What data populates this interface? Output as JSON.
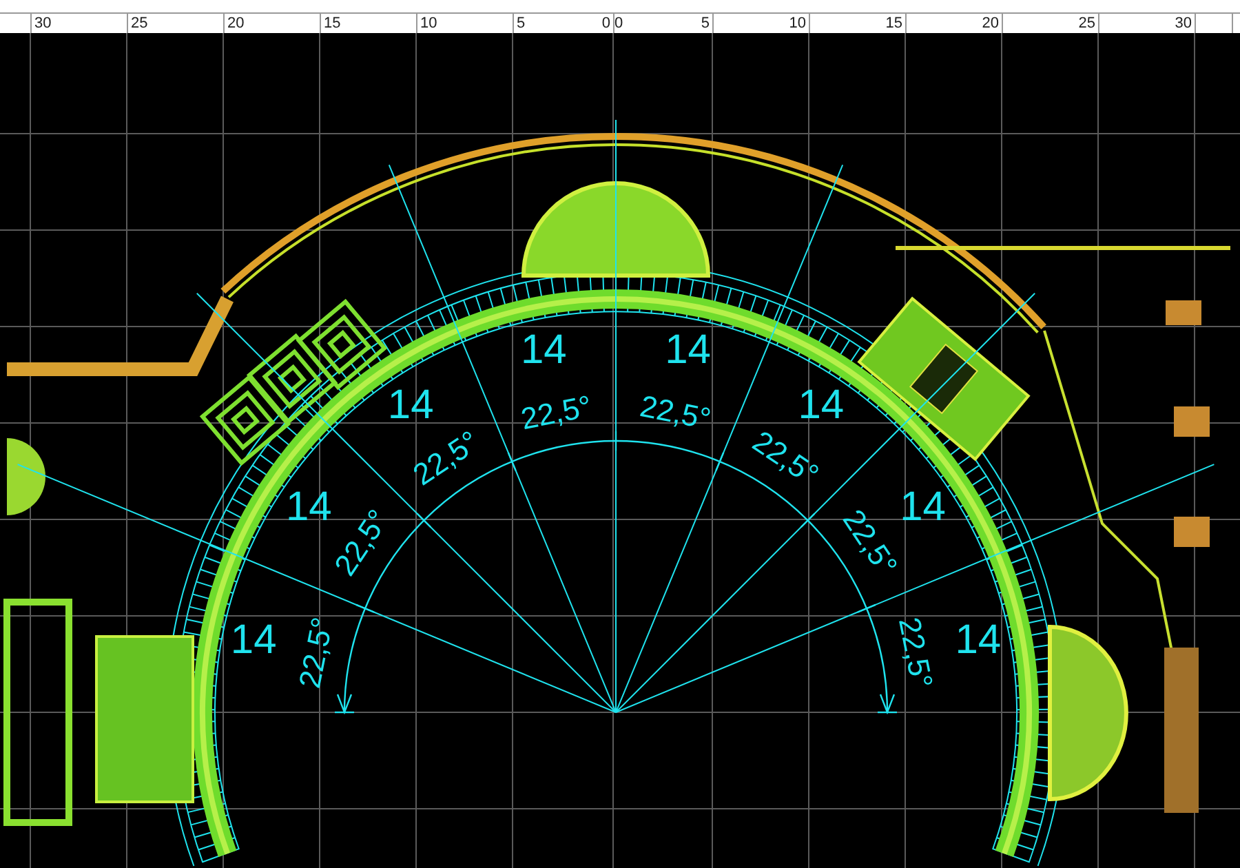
{
  "ruler": {
    "left_labels": [
      "30",
      "25",
      "20",
      "15",
      "10",
      "5",
      "0"
    ],
    "right_labels": [
      "0",
      "5",
      "10",
      "15",
      "20",
      "25",
      "30"
    ]
  },
  "plan": {
    "sector_labels": [
      "14",
      "14",
      "14",
      "14",
      "14",
      "14",
      "14",
      "14"
    ],
    "angle_labels": [
      "22,5°",
      "22,5°",
      "22,5°",
      "22,5°",
      "22,5°",
      "22,5°",
      "22,5°",
      "22,5°"
    ]
  }
}
